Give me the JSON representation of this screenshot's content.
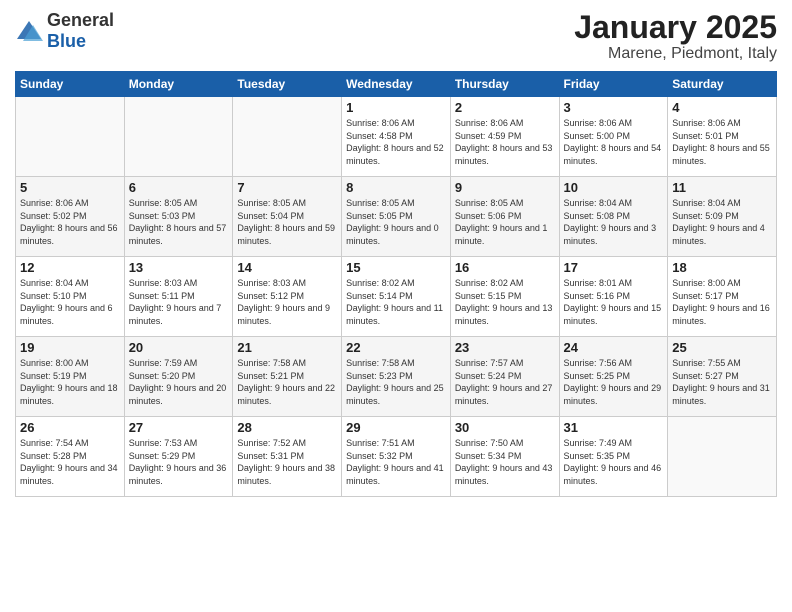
{
  "logo": {
    "general": "General",
    "blue": "Blue"
  },
  "title": "January 2025",
  "subtitle": "Marene, Piedmont, Italy",
  "days": [
    "Sunday",
    "Monday",
    "Tuesday",
    "Wednesday",
    "Thursday",
    "Friday",
    "Saturday"
  ],
  "weeks": [
    [
      {
        "day": "",
        "content": ""
      },
      {
        "day": "",
        "content": ""
      },
      {
        "day": "",
        "content": ""
      },
      {
        "day": "1",
        "content": "Sunrise: 8:06 AM\nSunset: 4:58 PM\nDaylight: 8 hours and 52 minutes."
      },
      {
        "day": "2",
        "content": "Sunrise: 8:06 AM\nSunset: 4:59 PM\nDaylight: 8 hours and 53 minutes."
      },
      {
        "day": "3",
        "content": "Sunrise: 8:06 AM\nSunset: 5:00 PM\nDaylight: 8 hours and 54 minutes."
      },
      {
        "day": "4",
        "content": "Sunrise: 8:06 AM\nSunset: 5:01 PM\nDaylight: 8 hours and 55 minutes."
      }
    ],
    [
      {
        "day": "5",
        "content": "Sunrise: 8:06 AM\nSunset: 5:02 PM\nDaylight: 8 hours and 56 minutes."
      },
      {
        "day": "6",
        "content": "Sunrise: 8:05 AM\nSunset: 5:03 PM\nDaylight: 8 hours and 57 minutes."
      },
      {
        "day": "7",
        "content": "Sunrise: 8:05 AM\nSunset: 5:04 PM\nDaylight: 8 hours and 59 minutes."
      },
      {
        "day": "8",
        "content": "Sunrise: 8:05 AM\nSunset: 5:05 PM\nDaylight: 9 hours and 0 minutes."
      },
      {
        "day": "9",
        "content": "Sunrise: 8:05 AM\nSunset: 5:06 PM\nDaylight: 9 hours and 1 minute."
      },
      {
        "day": "10",
        "content": "Sunrise: 8:04 AM\nSunset: 5:08 PM\nDaylight: 9 hours and 3 minutes."
      },
      {
        "day": "11",
        "content": "Sunrise: 8:04 AM\nSunset: 5:09 PM\nDaylight: 9 hours and 4 minutes."
      }
    ],
    [
      {
        "day": "12",
        "content": "Sunrise: 8:04 AM\nSunset: 5:10 PM\nDaylight: 9 hours and 6 minutes."
      },
      {
        "day": "13",
        "content": "Sunrise: 8:03 AM\nSunset: 5:11 PM\nDaylight: 9 hours and 7 minutes."
      },
      {
        "day": "14",
        "content": "Sunrise: 8:03 AM\nSunset: 5:12 PM\nDaylight: 9 hours and 9 minutes."
      },
      {
        "day": "15",
        "content": "Sunrise: 8:02 AM\nSunset: 5:14 PM\nDaylight: 9 hours and 11 minutes."
      },
      {
        "day": "16",
        "content": "Sunrise: 8:02 AM\nSunset: 5:15 PM\nDaylight: 9 hours and 13 minutes."
      },
      {
        "day": "17",
        "content": "Sunrise: 8:01 AM\nSunset: 5:16 PM\nDaylight: 9 hours and 15 minutes."
      },
      {
        "day": "18",
        "content": "Sunrise: 8:00 AM\nSunset: 5:17 PM\nDaylight: 9 hours and 16 minutes."
      }
    ],
    [
      {
        "day": "19",
        "content": "Sunrise: 8:00 AM\nSunset: 5:19 PM\nDaylight: 9 hours and 18 minutes."
      },
      {
        "day": "20",
        "content": "Sunrise: 7:59 AM\nSunset: 5:20 PM\nDaylight: 9 hours and 20 minutes."
      },
      {
        "day": "21",
        "content": "Sunrise: 7:58 AM\nSunset: 5:21 PM\nDaylight: 9 hours and 22 minutes."
      },
      {
        "day": "22",
        "content": "Sunrise: 7:58 AM\nSunset: 5:23 PM\nDaylight: 9 hours and 25 minutes."
      },
      {
        "day": "23",
        "content": "Sunrise: 7:57 AM\nSunset: 5:24 PM\nDaylight: 9 hours and 27 minutes."
      },
      {
        "day": "24",
        "content": "Sunrise: 7:56 AM\nSunset: 5:25 PM\nDaylight: 9 hours and 29 minutes."
      },
      {
        "day": "25",
        "content": "Sunrise: 7:55 AM\nSunset: 5:27 PM\nDaylight: 9 hours and 31 minutes."
      }
    ],
    [
      {
        "day": "26",
        "content": "Sunrise: 7:54 AM\nSunset: 5:28 PM\nDaylight: 9 hours and 34 minutes."
      },
      {
        "day": "27",
        "content": "Sunrise: 7:53 AM\nSunset: 5:29 PM\nDaylight: 9 hours and 36 minutes."
      },
      {
        "day": "28",
        "content": "Sunrise: 7:52 AM\nSunset: 5:31 PM\nDaylight: 9 hours and 38 minutes."
      },
      {
        "day": "29",
        "content": "Sunrise: 7:51 AM\nSunset: 5:32 PM\nDaylight: 9 hours and 41 minutes."
      },
      {
        "day": "30",
        "content": "Sunrise: 7:50 AM\nSunset: 5:34 PM\nDaylight: 9 hours and 43 minutes."
      },
      {
        "day": "31",
        "content": "Sunrise: 7:49 AM\nSunset: 5:35 PM\nDaylight: 9 hours and 46 minutes."
      },
      {
        "day": "",
        "content": ""
      }
    ]
  ]
}
